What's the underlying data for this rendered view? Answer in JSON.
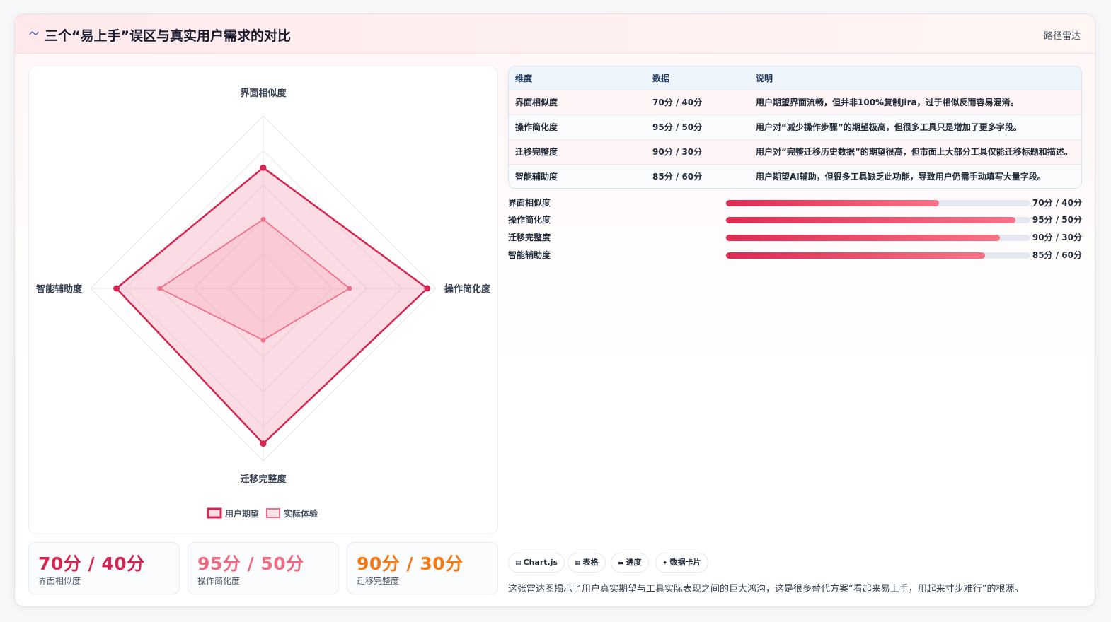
{
  "header": {
    "icon": "wave-icon",
    "title": "三个“易上手”误区与真实用户需求的对比",
    "tag": "路径雷达"
  },
  "colors": {
    "expected": "#d42650",
    "expected_fill": "rgba(244,114,146,0.25)",
    "actual": "#f0708a",
    "actual_fill": "rgba(244,150,166,0.25)",
    "stat1": "#d42650",
    "stat2": "#f06a82",
    "stat3": "#f57a14"
  },
  "chart_data": {
    "type": "radar",
    "axes": [
      "界面相似度",
      "操作简化度",
      "迁移完整度",
      "智能辅助度"
    ],
    "range": [
      0,
      100
    ],
    "grid": true,
    "legend_position": "bottom",
    "series": [
      {
        "name": "用户期望",
        "values": [
          70,
          95,
          90,
          85
        ]
      },
      {
        "name": "实际体验",
        "values": [
          40,
          50,
          30,
          60
        ]
      }
    ]
  },
  "table": {
    "headers": [
      "维度",
      "数据",
      "说明"
    ],
    "rows": [
      [
        "界面相似度",
        "70分 / 40分",
        "用户期望界面流畅，但并非100%复制Jira，过于相似反而容易混淆。"
      ],
      [
        "操作简化度",
        "95分 / 50分",
        "用户对“减少操作步骤”的期望极高，但很多工具只是增加了更多字段。"
      ],
      [
        "迁移完整度",
        "90分 / 30分",
        "用户对“完整迁移历史数据”的期望很高，但市面上大部分工具仅能迁移标题和描述。"
      ],
      [
        "智能辅助度",
        "85分 / 60分",
        "用户期望AI辅助，但很多工具缺乏此功能，导致用户仍需手动填写大量字段。"
      ]
    ]
  },
  "bars": [
    {
      "label": "界面相似度",
      "value": "70分 / 40分",
      "fill": 0.7
    },
    {
      "label": "操作简化度",
      "value": "95分 / 50分",
      "fill": 0.95
    },
    {
      "label": "迁移完整度",
      "value": "90分 / 30分",
      "fill": 0.9
    },
    {
      "label": "智能辅助度",
      "value": "85分 / 60分",
      "fill": 0.85
    }
  ],
  "stats": [
    {
      "value": "70分 / 40分",
      "label": "界面相似度"
    },
    {
      "value": "95分 / 50分",
      "label": "操作简化度"
    },
    {
      "value": "90分 / 30分",
      "label": "迁移完整度"
    }
  ],
  "chips": [
    {
      "icon": "chart-icon",
      "glyph": "▤",
      "label": "Chart.js"
    },
    {
      "icon": "table-icon",
      "glyph": "▦",
      "label": "表格"
    },
    {
      "icon": "progress-icon",
      "glyph": "▬",
      "label": "进度"
    },
    {
      "icon": "sparkle-icon",
      "glyph": "✦",
      "label": "数据卡片"
    }
  ],
  "footnote": "这张雷达图揭示了用户真实期望与工具实际表现之间的巨大鸿沟，这是很多替代方案“看起来易上手，用起来寸步难行”的根源。"
}
